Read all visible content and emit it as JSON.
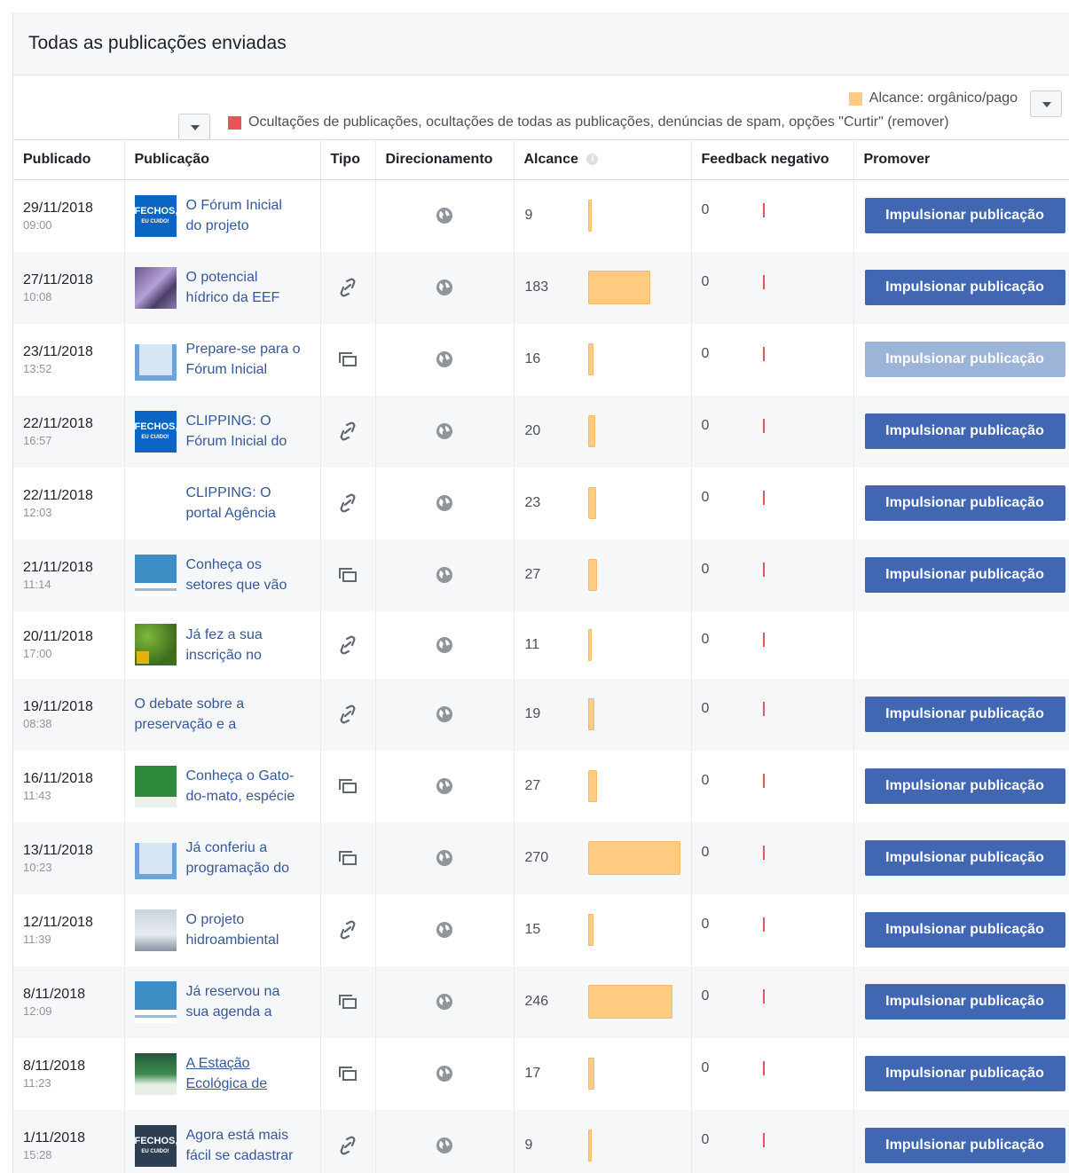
{
  "panel": {
    "title": "Todas as publicações enviadas"
  },
  "legend": {
    "reach_label": "Alcance: orgânico/pago",
    "reach_color": "#ffcb80",
    "negative_label": "Ocultações de publicações, ocultações de todas as publicações, denúncias de spam, opções \"Curtir\" (remover)",
    "negative_color": "#e9545a"
  },
  "columns": {
    "published": "Publicado",
    "post": "Publicação",
    "type": "Tipo",
    "targeting": "Direcionamento",
    "reach": "Alcance",
    "negative": "Feedback negativo",
    "promote": "Promover"
  },
  "boost_label": "Impulsionar publicação",
  "rows": [
    {
      "date": "29/11/2018",
      "time": "09:00",
      "text": "O Fórum Inicial do projeto",
      "type": "",
      "reach": "9",
      "negative": "0"
    },
    {
      "date": "27/11/2018",
      "time": "10:08",
      "text": "O potencial hídrico da EEF",
      "type": "link-icon",
      "reach": "183",
      "negative": "0"
    },
    {
      "date": "23/11/2018",
      "time": "13:52",
      "text": "Prepare-se para o Fórum Inicial",
      "type": "album-icon",
      "reach": "16",
      "negative": "0"
    },
    {
      "date": "22/11/2018",
      "time": "16:57",
      "text": "CLIPPING: O Fórum Inicial do",
      "type": "link-icon",
      "reach": "20",
      "negative": "0"
    },
    {
      "date": "22/11/2018",
      "time": "12:03",
      "text": "CLIPPING: O portal Agência",
      "type": "link-icon",
      "reach": "23",
      "negative": "0"
    },
    {
      "date": "21/11/2018",
      "time": "11:14",
      "text": "Conheça os setores que vão",
      "type": "album-icon",
      "reach": "27",
      "negative": "0"
    },
    {
      "date": "20/11/2018",
      "time": "17:00",
      "text": "Já fez a sua inscrição no",
      "type": "link-icon",
      "reach": "11",
      "negative": "0"
    },
    {
      "date": "19/11/2018",
      "time": "08:38",
      "text": "O debate sobre a preservação e a",
      "type": "link-icon",
      "reach": "19",
      "negative": "0"
    },
    {
      "date": "16/11/2018",
      "time": "11:43",
      "text": "Conheça o Gato-do-mato, espécie",
      "type": "album-icon",
      "reach": "27",
      "negative": "0"
    },
    {
      "date": "13/11/2018",
      "time": "10:23",
      "text": "Já conferiu a programação do",
      "type": "album-icon",
      "reach": "270",
      "negative": "0"
    },
    {
      "date": "12/11/2018",
      "time": "11:39",
      "text": "O projeto hidroambiental",
      "type": "link-icon",
      "reach": "15",
      "negative": "0"
    },
    {
      "date": "8/11/2018",
      "time": "12:09",
      "text": "Já reservou na sua agenda a",
      "type": "album-icon",
      "reach": "246",
      "negative": "0"
    },
    {
      "date": "8/11/2018",
      "time": "11:23",
      "text": "A Estação Ecológica de",
      "type": "album-icon",
      "reach": "17",
      "negative": "0"
    },
    {
      "date": "1/11/2018",
      "time": "15:28",
      "text": "Agora está mais fácil se cadastrar",
      "type": "link-icon",
      "reach": "9",
      "negative": "0"
    }
  ],
  "thumb_texts": {
    "fechos": "FECHOS,",
    "eu_cuido": "EU CUIDO!"
  }
}
